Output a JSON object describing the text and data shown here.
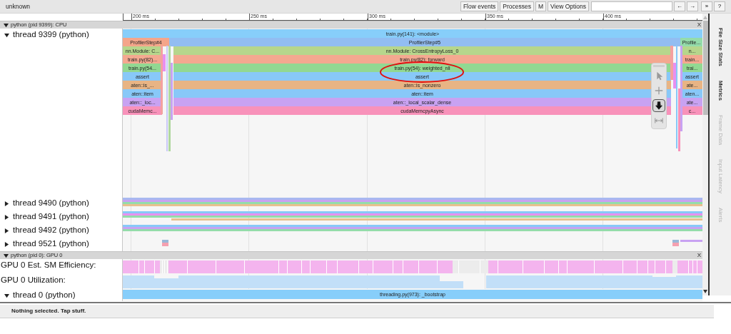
{
  "title": "unknown",
  "toolbar": {
    "buttons": [
      "Flow events",
      "Processes",
      "M",
      "View Options"
    ],
    "nav_buttons": [
      "←",
      "→",
      "»",
      "?"
    ]
  },
  "ruler": {
    "ticks": [
      "200 ms",
      "250 ms",
      "300 ms",
      "350 ms",
      "400 ms"
    ]
  },
  "processes": [
    {
      "title": "python (pid 9399): CPU",
      "expanded": true,
      "close": "X",
      "tracks": [
        {
          "kind": "flame",
          "label": "thread 9399 (python)",
          "expanded": true,
          "root": {
            "label": "train.py(141): <module>",
            "color": "#87cefa"
          },
          "steps": [
            {
              "label": "ProfilerStep#4",
              "color": "#f4a58a"
            },
            {
              "label": "ProfilerStep#5",
              "color": "#92bdf2"
            },
            {
              "label": "Profile...",
              "color": "#94dcaa"
            }
          ],
          "rows": [
            [
              {
                "label": "nn.Module: C...",
                "color": "#b6d68c"
              },
              {
                "label": "nn.Module: CrossEntropyLoss_0",
                "color": "#b6d68c"
              },
              {
                "label": "n...",
                "color": "#b6d68c"
              }
            ],
            [
              {
                "label": "train.py(82)...",
                "color": "#f4a890"
              },
              {
                "label": "train.py(82): forward",
                "color": "#f4a890"
              },
              {
                "label": "train...",
                "color": "#f4a890"
              }
            ],
            [
              {
                "label": "train.py(54...",
                "color": "#92d892"
              },
              {
                "label": "train.py(54): weighted_nll",
                "color": "#92d892"
              },
              {
                "label": "trai...",
                "color": "#92d892"
              }
            ],
            [
              {
                "label": "assert",
                "color": "#88c8f8"
              },
              {
                "label": "assert",
                "color": "#88c8f8"
              },
              {
                "label": "assert",
                "color": "#88c8f8"
              }
            ],
            [
              {
                "label": "aten::is_...",
                "color": "#e8b484"
              },
              {
                "label": "aten::is_nonzero",
                "color": "#e8b484"
              },
              {
                "label": "ate...",
                "color": "#e8b484"
              }
            ],
            [
              {
                "label": "aten::item",
                "color": "#88c8f8"
              },
              {
                "label": "aten::item",
                "color": "#88c8f8"
              },
              {
                "label": "aten...",
                "color": "#88c8f8"
              }
            ],
            [
              {
                "label": "aten::_loc...",
                "color": "#c8a2f2"
              },
              {
                "label": "aten::_local_scalar_dense",
                "color": "#c8a2f2"
              },
              {
                "label": "ate...",
                "color": "#c8a2f2"
              }
            ],
            [
              {
                "label": "cudaMemc...",
                "color": "#f892ba"
              },
              {
                "label": "cudaMemcpyAsync",
                "color": "#f892ba"
              },
              {
                "label": "c...",
                "color": "#f892ba"
              }
            ]
          ]
        },
        {
          "kind": "thread",
          "label": "thread 9490 (python)",
          "expanded": false
        },
        {
          "kind": "thread",
          "label": "thread 9491 (python)",
          "expanded": false
        },
        {
          "kind": "thread",
          "label": "thread 9492 (python)",
          "expanded": false
        },
        {
          "kind": "thread",
          "label": "thread 9521 (python)",
          "expanded": false
        }
      ]
    },
    {
      "title": "python (pid 0): GPU 0",
      "expanded": true,
      "close": "X",
      "tracks": [
        {
          "kind": "counter",
          "label": "GPU 0 Est. SM Efficiency:"
        },
        {
          "kind": "counter",
          "label": "GPU 0 Utilization:"
        },
        {
          "kind": "slice_thread",
          "label": "thread 0 (python)",
          "expanded": true,
          "slice": {
            "label": "threading.py(973): _bootstrap",
            "color": "#87cefa"
          }
        }
      ]
    }
  ],
  "tools": [
    {
      "kind": "select",
      "selected": false
    },
    {
      "kind": "pan",
      "selected": false
    },
    {
      "kind": "zoom",
      "selected": true
    },
    {
      "kind": "timing",
      "selected": false
    }
  ],
  "side_tabs": [
    {
      "label": "File Size Stats",
      "disabled": false
    },
    {
      "label": "Metrics",
      "disabled": false
    },
    {
      "label": "Frame Data",
      "disabled": true
    },
    {
      "label": "Input Latency",
      "disabled": true
    },
    {
      "label": "Alerts",
      "disabled": true
    }
  ],
  "status": "Nothing selected. Tap stuff."
}
